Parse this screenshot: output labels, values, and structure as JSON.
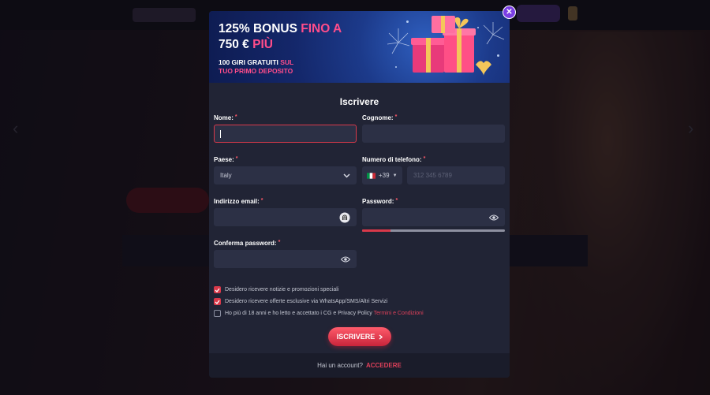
{
  "banner": {
    "title_part1": "125% BONUS ",
    "title_part2": "FINO A",
    "title_part3": "750 € ",
    "title_part4": "PIÙ",
    "sub_part1": "100 GIRI GRATUITI ",
    "sub_part2": "SUL",
    "sub_part3": "TUO PRIMO DEPOSITO"
  },
  "form": {
    "title": "Iscrivere",
    "name_label": "Nome:",
    "surname_label": "Cognome:",
    "country_label": "Paese:",
    "country_value": "Italy",
    "phone_label": "Numero di telefono:",
    "phone_code": "+39",
    "phone_placeholder": "312 345 6789",
    "email_label": "Indirizzo email:",
    "password_label": "Password:",
    "password_strength": 0.2,
    "confirm_label": "Conferma password:",
    "required_mark": "*"
  },
  "checkboxes": [
    {
      "text": "Desidero ricevere notizie e promozioni speciali",
      "checked": true
    },
    {
      "text": "Desidero ricevere offerte esclusive via WhatsApp/SMS/Altri Servizi",
      "checked": true
    },
    {
      "text": "Ho più di 18 anni e ho letto e accettato i CG e Privacy Policy ",
      "link": "Termini e Condizioni",
      "checked": false
    }
  ],
  "submit_label": "ISCRIVERE",
  "footer": {
    "question": "Hai un account?",
    "login_label": "ACCEDERE"
  },
  "colors": {
    "accent": "#d9394a",
    "close": "#7b3fe4",
    "modal_bg": "#212435",
    "input_bg": "#2c3045"
  },
  "icons": {
    "close": "close-icon",
    "chevron": "chevron-down-icon",
    "eye": "eye-icon",
    "flag": "italy-flag-icon"
  }
}
